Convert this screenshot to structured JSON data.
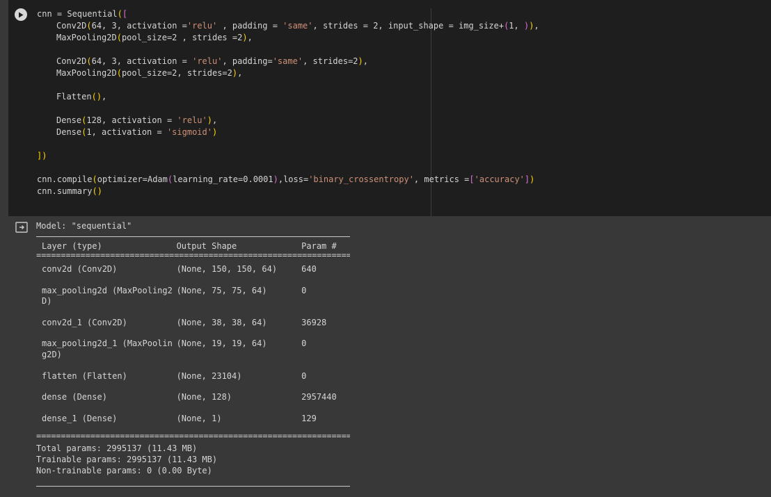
{
  "code_cell": {
    "run_button": "play-icon",
    "lines": [
      "cnn = Sequential([",
      "Conv2D(64, 3, activation ='relu' , padding = 'same', strides = 2, input_shape = img_size+(1, )),",
      "MaxPooling2D(pool_size=2 , strides =2),",
      "",
      "Conv2D(64, 3, activation = 'relu', padding='same', strides=2),",
      "MaxPooling2D(pool_size=2, strides=2),",
      "",
      "Flatten(),",
      "",
      "Dense(128, activation = 'relu'),",
      "Dense(1, activation = 'sigmoid')",
      "",
      "])",
      "",
      "cnn.compile(optimizer=Adam(learning_rate=0.0001),loss='binary_crossentropy', metrics =['accuracy'])",
      "cnn.summary()"
    ]
  },
  "output": {
    "icon": "output-redirect-icon",
    "model_title": "Model: \"sequential\"",
    "headers": {
      "name": "Layer (type)",
      "shape": "Output Shape",
      "params": "Param #"
    },
    "separator": "=================================================================",
    "layers": [
      {
        "name": "conv2d (Conv2D)",
        "shape": "(None, 150, 150, 64)",
        "params": "640"
      },
      {
        "name": "max_pooling2d (MaxPooling2\nD)",
        "shape": "(None, 75, 75, 64)",
        "params": "0"
      },
      {
        "name": "conv2d_1 (Conv2D)",
        "shape": "(None, 38, 38, 64)",
        "params": "36928"
      },
      {
        "name": "max_pooling2d_1 (MaxPoolin\ng2D)",
        "shape": "(None, 19, 19, 64)",
        "params": "0"
      },
      {
        "name": "flatten (Flatten)",
        "shape": "(None, 23104)",
        "params": "0"
      },
      {
        "name": "dense (Dense)",
        "shape": "(None, 128)",
        "params": "2957440"
      },
      {
        "name": "dense_1 (Dense)",
        "shape": "(None, 1)",
        "params": "129"
      }
    ],
    "totals": {
      "total": "Total params: 2995137 (11.43 MB)",
      "trainable": "Trainable params: 2995137 (11.43 MB)",
      "non_trainable": "Non-trainable params: 0 (0.00 Byte)"
    }
  }
}
